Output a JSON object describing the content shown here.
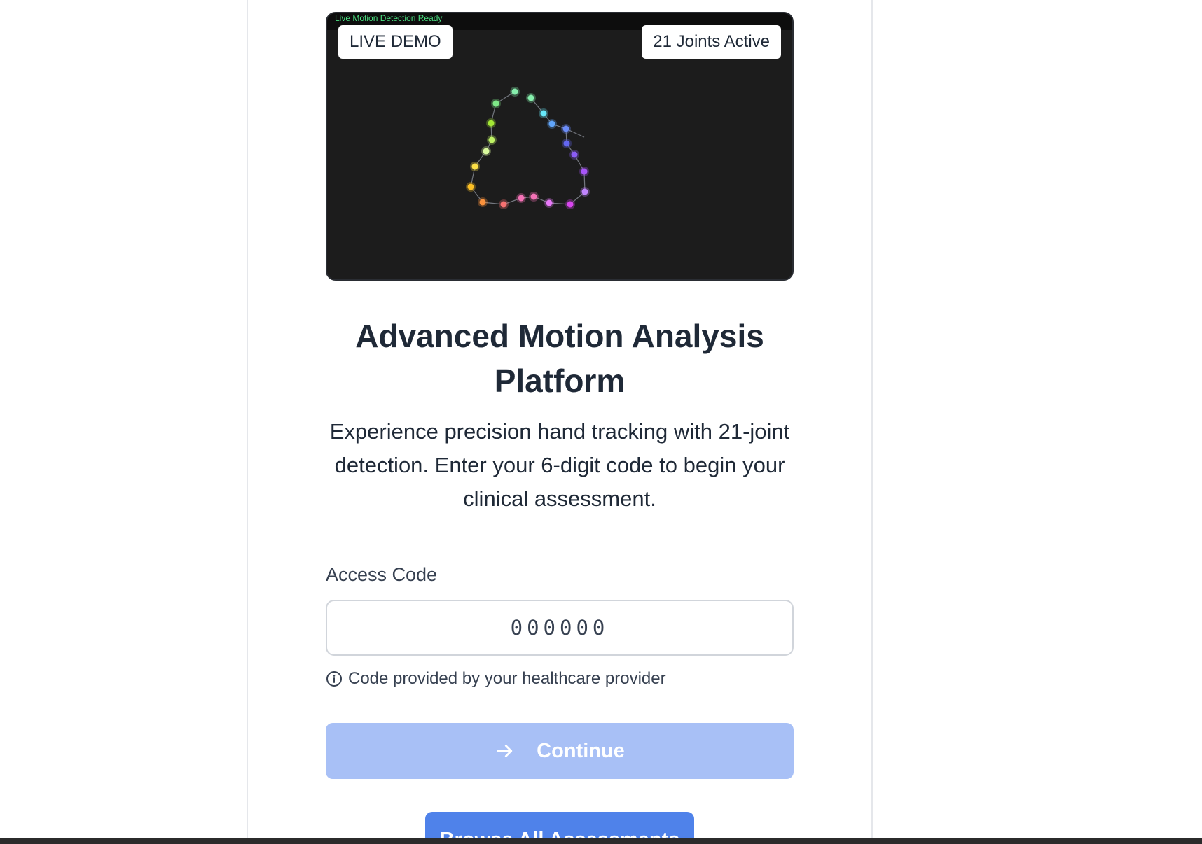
{
  "demo": {
    "status_text": "Live Motion Detection Ready",
    "live_badge": "LIVE DEMO",
    "joints_badge": "21 Joints Active"
  },
  "hero": {
    "title": "Advanced Motion Analysis Platform",
    "subtitle": "Experience precision hand tracking with 21-joint detection. Enter your 6-digit code to begin your clinical assessment."
  },
  "form": {
    "access_code_label": "Access Code",
    "access_code_placeholder": "000000",
    "access_code_value": "",
    "hint": "Code provided by your healthcare provider",
    "hint_icon": "info-icon",
    "continue_label": "Continue",
    "continue_icon": "arrow-right-icon",
    "browse_label": "Browse All Assessments"
  },
  "colors": {
    "continue_disabled": "#a8c0f6",
    "browse_primary": "#4f82ea",
    "demo_background": "#1c1c1c",
    "status_green": "#4ade80"
  }
}
